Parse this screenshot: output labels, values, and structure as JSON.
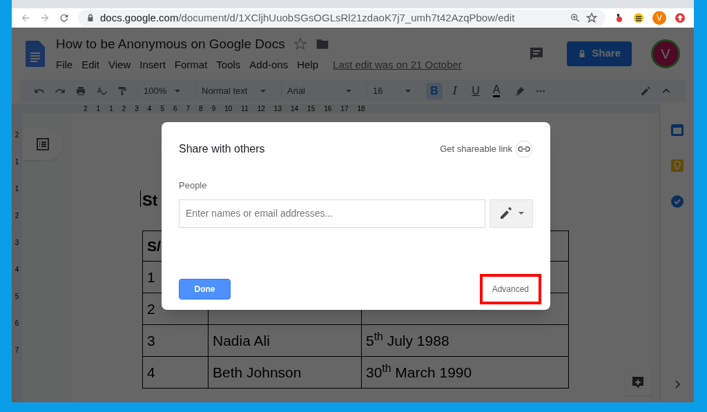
{
  "browser": {
    "url_host": "docs.google.com",
    "url_path": "/document/d/1XCljhUuobSGsOGLsRl21zdaoK7j7_umh7t42AzqPbow/edit",
    "profile_initial": "V"
  },
  "doc": {
    "title": "How to be Anonymous on Google Docs",
    "menu": [
      "File",
      "Edit",
      "View",
      "Insert",
      "Format",
      "Tools",
      "Add-ons",
      "Help"
    ],
    "last_edit": "Last edit was on 21 October",
    "share_button": "Share",
    "avatar_initial": "V"
  },
  "toolbar": {
    "zoom": "100%",
    "style": "Normal text",
    "font": "Arial",
    "size": "16",
    "formats": [
      {
        "kind": "bold",
        "label": "B",
        "selected": true
      },
      {
        "kind": "italic",
        "label": "I",
        "selected": false
      },
      {
        "kind": "underline",
        "label": "U",
        "selected": false
      },
      {
        "kind": "color",
        "label": "A",
        "selected": false
      }
    ]
  },
  "ruler": {
    "horizontal": [
      "2",
      "1",
      "1",
      "2",
      "3",
      "4",
      "5",
      "6",
      "7",
      "8",
      "9",
      "10",
      "11",
      "12",
      "13",
      "14",
      "15",
      "16",
      "17",
      "18"
    ],
    "vertical": [
      "2",
      "1",
      "1",
      "2",
      "3",
      "4",
      "5",
      "6",
      "7"
    ]
  },
  "page": {
    "heading": "St",
    "header": [
      "S/"
    ],
    "rows": [
      [
        "1"
      ],
      [
        "2"
      ],
      [
        "3",
        "Nadia Ali",
        "5$^{th}$ July 1988"
      ],
      [
        "4",
        "Beth Johnson",
        "30$^{th}$ March 1990"
      ]
    ]
  },
  "dialog": {
    "title": "Share with others",
    "link": "Get shareable link",
    "people_label": "People",
    "placeholder": "Enter names or email addresses...",
    "done": "Done",
    "advanced": "Advanced",
    "advanced_highlighted": true
  }
}
